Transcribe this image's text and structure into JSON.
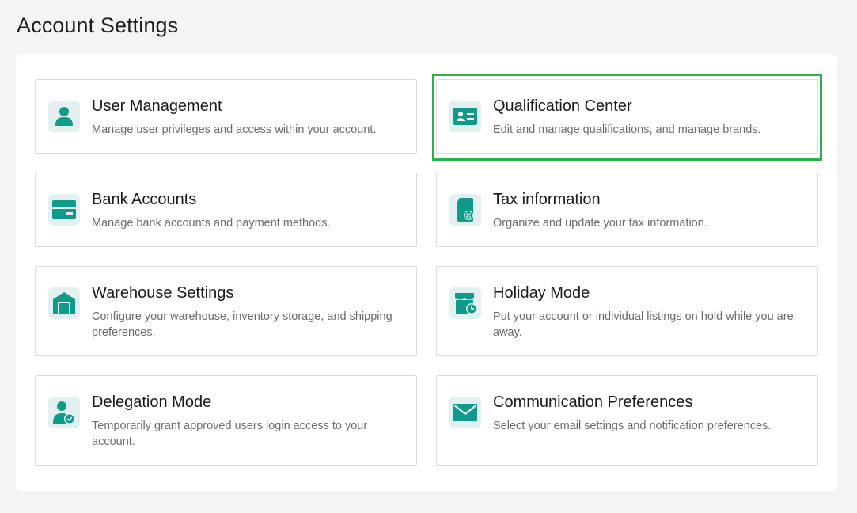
{
  "page_title": "Account Settings",
  "accent_color": "#109a8b",
  "icon_bg_color": "#e2f1ef",
  "highlight_color": "#2fae4c",
  "cards": [
    {
      "title": "User Management",
      "description": "Manage user privileges and access within your account.",
      "icon": "user-icon"
    },
    {
      "title": "Qualification Center",
      "description": "Edit and manage qualifications, and manage brands.",
      "icon": "id-card-icon",
      "highlighted": true
    },
    {
      "title": "Bank Accounts",
      "description": "Manage bank accounts and payment methods.",
      "icon": "credit-card-icon"
    },
    {
      "title": "Tax information",
      "description": "Organize and update your tax information.",
      "icon": "tax-document-icon"
    },
    {
      "title": "Warehouse Settings",
      "description": "Configure your warehouse, inventory storage, and shipping preferences.",
      "icon": "warehouse-icon"
    },
    {
      "title": "Holiday Mode",
      "description": "Put your account or individual listings on hold while you are away.",
      "icon": "store-clock-icon"
    },
    {
      "title": "Delegation Mode",
      "description": "Temporarily grant approved users login access to your account.",
      "icon": "user-check-icon"
    },
    {
      "title": "Communication Preferences",
      "description": "Select your email settings and notification preferences.",
      "icon": "envelope-icon"
    }
  ]
}
